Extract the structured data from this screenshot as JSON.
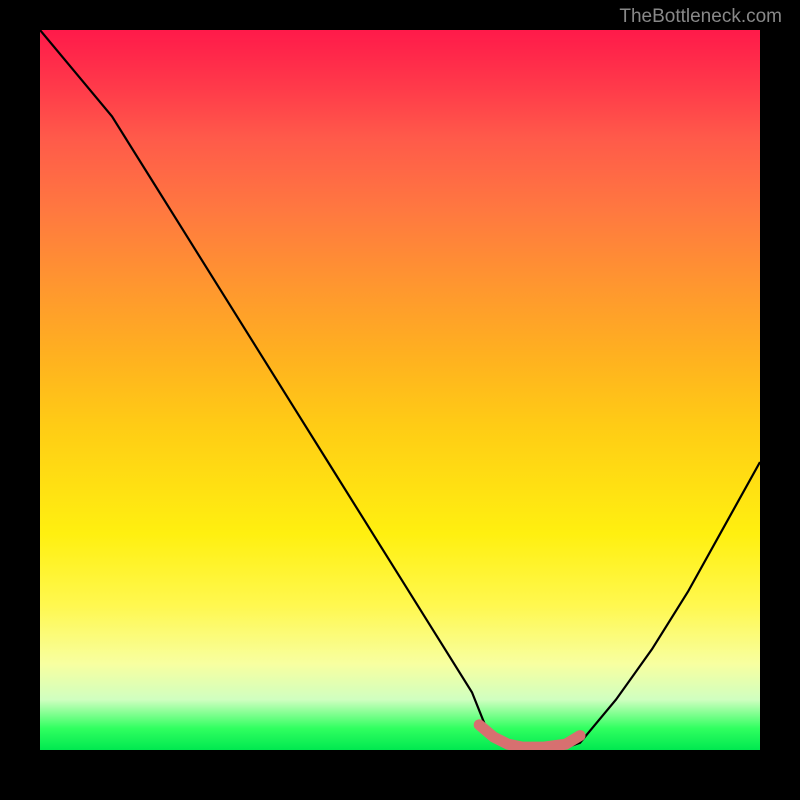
{
  "watermark": "TheBottleneck.com",
  "chart_data": {
    "type": "line",
    "title": "",
    "xlabel": "",
    "ylabel": "",
    "xlim": [
      0,
      100
    ],
    "ylim": [
      0,
      100
    ],
    "series": [
      {
        "name": "bottleneck-curve",
        "x": [
          0,
          5,
          10,
          15,
          20,
          25,
          30,
          35,
          40,
          45,
          50,
          55,
          60,
          62,
          66,
          72,
          75,
          80,
          85,
          90,
          95,
          100
        ],
        "values": [
          100,
          94,
          88,
          80,
          72,
          64,
          56,
          48,
          40,
          32,
          24,
          16,
          8,
          3,
          0,
          0,
          1,
          7,
          14,
          22,
          31,
          40
        ]
      },
      {
        "name": "highlight-segment",
        "x": [
          61,
          63,
          65,
          67,
          70,
          73,
          75
        ],
        "values": [
          3.5,
          1.8,
          0.8,
          0.4,
          0.4,
          0.8,
          2.0
        ]
      }
    ],
    "gradient_stops": [
      {
        "pos": 0,
        "color": "#ff1a4a"
      },
      {
        "pos": 50,
        "color": "#ffcc15"
      },
      {
        "pos": 90,
        "color": "#f8ffa0"
      },
      {
        "pos": 100,
        "color": "#00e850"
      }
    ]
  }
}
